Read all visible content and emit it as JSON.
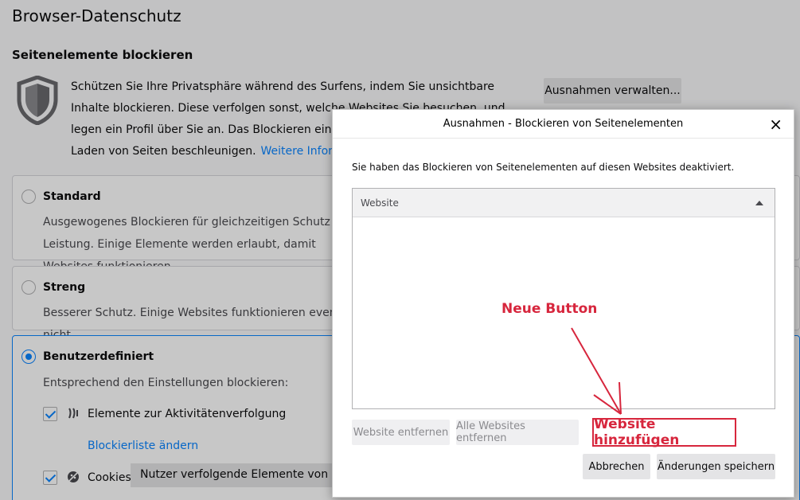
{
  "page": {
    "title": "Browser-Datenschutz",
    "section_title": "Seitenelemente blockieren",
    "description": "Schützen Sie Ihre Privatsphäre während des Surfens, indem Sie unsichtbare Inhalte blockieren. Diese verfolgen sonst, welche Websites Sie besuchen, und legen ein Profil über Sie an. Das Blockieren einiger dieser Inhalte kann das Laden von Seiten beschleunigen.",
    "more_info_link": "Weitere Informationen",
    "manage_exceptions_button": "Ausnahmen verwalten...",
    "options": {
      "standard": {
        "label": "Standard",
        "text": "Ausgewogenes Blockieren für gleichzeitigen Schutz und Leistung. Einige Elemente werden erlaubt, damit Websites funktionieren."
      },
      "strict": {
        "label": "Streng",
        "text": "Besserer Schutz. Einige Websites funktionieren eventuell nicht."
      },
      "custom": {
        "label": "Benutzerdefiniert",
        "text": "Entsprechend den Einstellungen blockieren:",
        "tracking_item": "Elemente zur Aktivitätenverfolgung",
        "blocklist_link": "Blockierliste ändern",
        "cookies_item": "Cookies",
        "cookies_select": "Nutzer verfolgende Elemente von Drittanbietern"
      }
    }
  },
  "dialog": {
    "title": "Ausnahmen - Blockieren von Seitenelementen",
    "close_glyph": "×",
    "intro": "Sie haben das Blockieren von Seitenelementen auf diesen Websites deaktiviert.",
    "column_header": "Website",
    "annotation": "Neue Button",
    "buttons": {
      "remove": "Website entfernen",
      "remove_all": "Alle Websites entfernen",
      "add": "Website hinzufügen",
      "cancel": "Abbrechen",
      "save": "Änderungen speichern"
    }
  },
  "colors": {
    "accent": "#0a84ff",
    "annotation": "#d7263d"
  },
  "icons": {
    "shield": "shield-icon",
    "tracking": "tracking-icon",
    "cookie": "cookie-icon",
    "close": "close-icon",
    "sort": "sort-ascending-icon"
  }
}
